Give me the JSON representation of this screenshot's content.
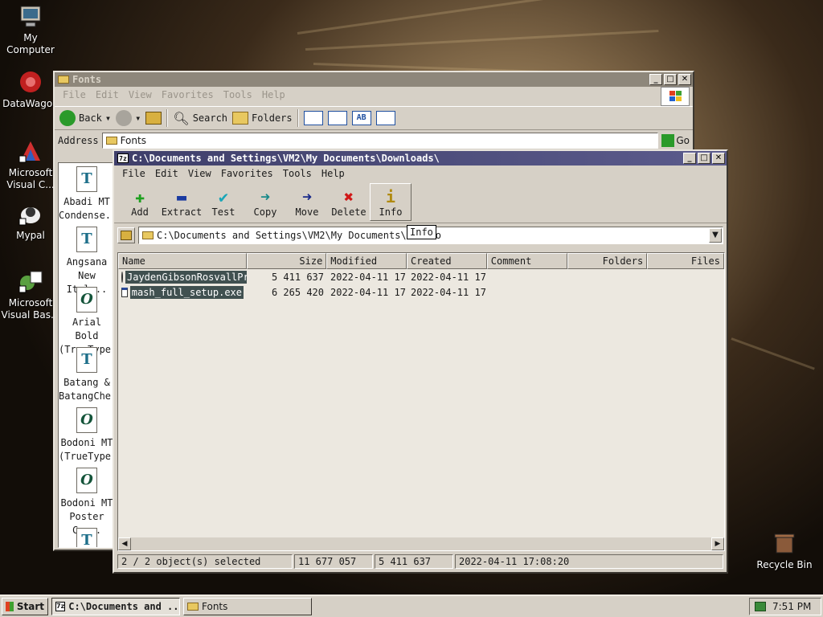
{
  "desktop": {
    "icons": [
      {
        "label": "My Computer"
      },
      {
        "label": "DataWagon"
      },
      {
        "label": "Microsoft Visual C..."
      },
      {
        "label": "Mypal"
      },
      {
        "label": "Microsoft Visual Bas..."
      },
      {
        "label": "Recycle Bin"
      }
    ]
  },
  "explorer": {
    "title": "Fonts",
    "menu": [
      "File",
      "Edit",
      "View",
      "Favorites",
      "Tools",
      "Help"
    ],
    "toolbar": {
      "back": "Back",
      "search": "Search",
      "folders": "Folders"
    },
    "address_label": "Address",
    "address_value": "Fonts",
    "go_label": "Go",
    "fonts": [
      {
        "line1": "Abadi MT",
        "line2": "Condense...",
        "kind": "T"
      },
      {
        "line1": "Angsana",
        "line2": "New Ital...",
        "kind": "T"
      },
      {
        "line1": "Arial Bold",
        "line2": "(TrueType)",
        "kind": "O"
      },
      {
        "line1": "Batang &",
        "line2": "BatangChe...",
        "kind": "T"
      },
      {
        "line1": "Bodoni MT",
        "line2": "(TrueType)",
        "kind": "O"
      },
      {
        "line1": "Bodoni MT",
        "line2": "Poster Co...",
        "kind": "O"
      },
      {
        "line1": "",
        "line2": "",
        "kind": "T"
      }
    ]
  },
  "sevenzip": {
    "title": "C:\\Documents and Settings\\VM2\\My Documents\\Downloads\\",
    "menu": [
      "File",
      "Edit",
      "View",
      "Favorites",
      "Tools",
      "Help"
    ],
    "toolbar": [
      {
        "label": "Add",
        "glyph": "+",
        "color": "#1ea01e"
      },
      {
        "label": "Extract",
        "glyph": "—",
        "color": "#1a3aa0"
      },
      {
        "label": "Test",
        "glyph": "✔",
        "color": "#19a6b8"
      },
      {
        "label": "Copy",
        "glyph": "➜",
        "color": "#1a8a8a"
      },
      {
        "label": "Move",
        "glyph": "➜",
        "color": "#1a2a8a"
      },
      {
        "label": "Delete",
        "glyph": "✖",
        "color": "#d01818"
      },
      {
        "label": "Info",
        "glyph": "i",
        "color": "#b08a10"
      }
    ],
    "path": "C:\\Documents and Settings\\VM2\\My Documents\\Downlo",
    "tooltip": "Info",
    "columns": [
      "Name",
      "Size",
      "Modified",
      "Created",
      "Comment",
      "Folders",
      "Files"
    ],
    "files": [
      {
        "name": "JaydenGibsonRosvallPr...",
        "size": "5 411 637",
        "modified": "2022-04-11 17...",
        "created": "2022-04-11 17..."
      },
      {
        "name": "mash_full_setup.exe",
        "size": "6 265 420",
        "modified": "2022-04-11 17...",
        "created": "2022-04-11 17..."
      }
    ],
    "status": {
      "selection": "2 / 2 object(s) selected",
      "total_size": "11 677 057",
      "selected_size": "5 411 637",
      "datetime": "2022-04-11 17:08:20"
    }
  },
  "taskbar": {
    "start": "Start",
    "tasks": [
      {
        "label": "C:\\Documents and ..."
      },
      {
        "label": "Fonts"
      }
    ],
    "clock": "7:51 PM"
  }
}
